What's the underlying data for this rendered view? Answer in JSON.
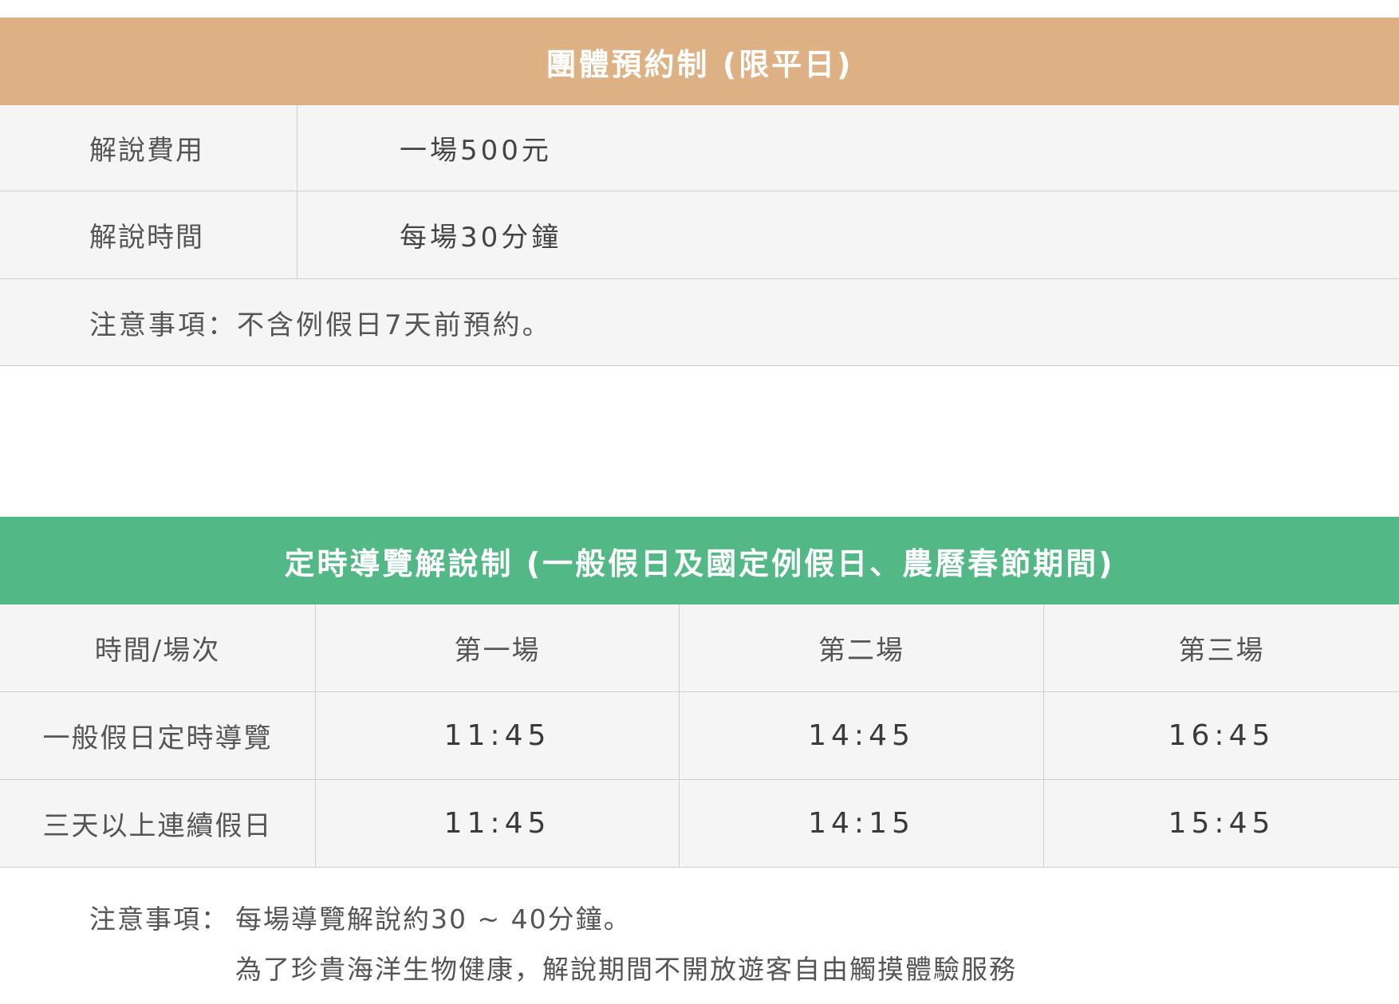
{
  "group": {
    "title": "團體預約制 (限平日)",
    "rows": [
      {
        "label": "解說費用",
        "value": "一場500元"
      },
      {
        "label": "解說時間",
        "value": "每場30分鐘"
      }
    ],
    "note": "注意事項：不含例假日7天前預約。",
    "header_color": "#ddb184"
  },
  "timed": {
    "title": "定時導覽解說制 (一般假日及國定例假日、農曆春節期間)",
    "columns": [
      "時間/場次",
      "第一場",
      "第二場",
      "第三場"
    ],
    "rows": [
      {
        "label": "一般假日定時導覽",
        "times": [
          "11:45",
          "14:45",
          "16:45"
        ]
      },
      {
        "label": "三天以上連續假日",
        "times": [
          "11:45",
          "14:15",
          "15:45"
        ]
      }
    ],
    "note_label": "注意事項：",
    "note_line1": "每場導覽解說約30 ~ 40分鐘。",
    "note_line2": "為了珍貴海洋生物健康，解說期間不開放遊客自由觸摸體驗服務",
    "header_color": "#52b886"
  }
}
